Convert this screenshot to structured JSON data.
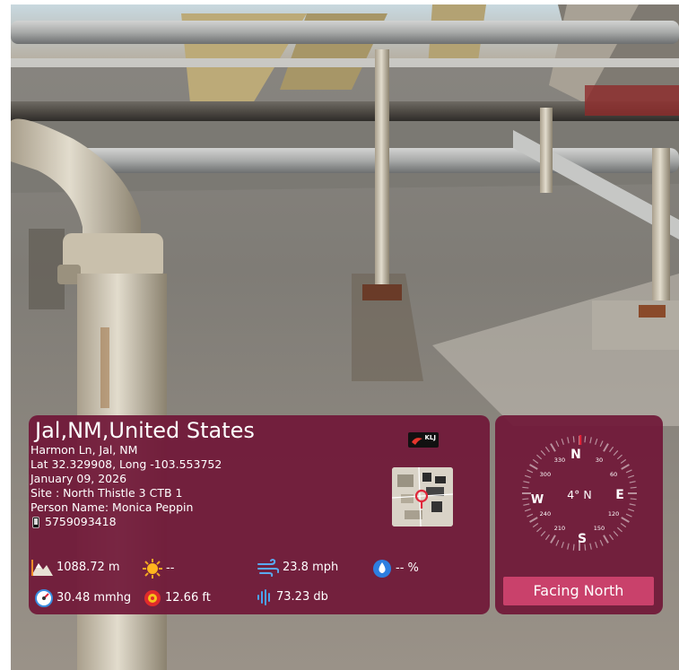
{
  "location": {
    "city": "Jal,NM,United States",
    "street": "Harmon Ln, Jal, NM",
    "coordinates": "Lat 32.329908, Long -103.553752",
    "date": "January 09, 2026",
    "site": "Site : North Thistle 3 CTB 1",
    "person": "Person Name: Monica Peppin",
    "phone": "5759093418"
  },
  "logo": {
    "text": "KLJ"
  },
  "stats": {
    "altitude": "1088.72 m",
    "weather": "--",
    "wind": "23.8 mph",
    "humidity": "-- %",
    "pressure": "30.48 mmhg",
    "accuracy": "12.66 ft",
    "sound": "73.23 db"
  },
  "compass": {
    "heading": "4° N",
    "north": "N",
    "east": "E",
    "south": "S",
    "west": "W",
    "degree_labels": [
      "30",
      "60",
      "120",
      "150",
      "210",
      "240",
      "300",
      "330"
    ],
    "facing": "Facing North"
  },
  "colors": {
    "card": "#701838",
    "button": "#c9416b",
    "compass_ring": "#b8909d"
  }
}
